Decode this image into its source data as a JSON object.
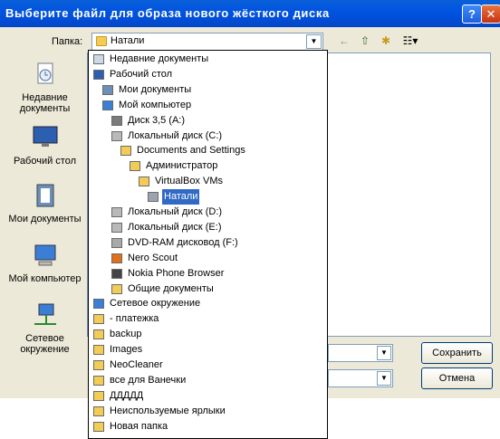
{
  "dialog": {
    "title": "Выберите файл для образа нового жёсткого диска",
    "help_label": "?",
    "close_label": "✕"
  },
  "lookin": {
    "label": "Папка:",
    "value": "Натали"
  },
  "toolbar": {
    "back": "←",
    "up": "⇧",
    "new_folder": "✱",
    "views": "☷▾"
  },
  "places": [
    {
      "label": "Недавние документы",
      "icon": "recent-documents-icon"
    },
    {
      "label": "Рабочий стол",
      "icon": "desktop-icon"
    },
    {
      "label": "Мои документы",
      "icon": "my-documents-icon"
    },
    {
      "label": "Мой компьютер",
      "icon": "my-computer-icon"
    },
    {
      "label": "Сетевое окружение",
      "icon": "network-icon"
    }
  ],
  "dropdown": {
    "items": [
      {
        "label": "Недавние документы",
        "indent": 0,
        "icon": "recent-icon"
      },
      {
        "label": "Рабочий стол",
        "indent": 0,
        "icon": "desktop-icon"
      },
      {
        "label": "Мои документы",
        "indent": 1,
        "icon": "my-documents-icon"
      },
      {
        "label": "Мой компьютер",
        "indent": 1,
        "icon": "computer-icon"
      },
      {
        "label": "Диск 3,5 (A:)",
        "indent": 2,
        "icon": "floppy-icon"
      },
      {
        "label": "Локальный диск (C:)",
        "indent": 2,
        "icon": "drive-icon"
      },
      {
        "label": "Documents and Settings",
        "indent": 3,
        "icon": "folder-icon"
      },
      {
        "label": "Администратор",
        "indent": 4,
        "icon": "folder-icon"
      },
      {
        "label": "VirtualBox VMs",
        "indent": 5,
        "icon": "folder-icon"
      },
      {
        "label": "Натали",
        "indent": 6,
        "icon": "folder-gray-icon",
        "selected": true
      },
      {
        "label": "Локальный диск (D:)",
        "indent": 2,
        "icon": "drive-icon"
      },
      {
        "label": "Локальный диск (E:)",
        "indent": 2,
        "icon": "drive-icon"
      },
      {
        "label": "DVD-RAM дисковод (F:)",
        "indent": 2,
        "icon": "dvd-icon"
      },
      {
        "label": "Nero Scout",
        "indent": 2,
        "icon": "nero-icon"
      },
      {
        "label": "Nokia Phone Browser",
        "indent": 2,
        "icon": "phone-icon"
      },
      {
        "label": "Общие документы",
        "indent": 2,
        "icon": "folder-icon"
      },
      {
        "label": "Сетевое окружение",
        "indent": 0,
        "icon": "network-icon"
      },
      {
        "label": "- платежка",
        "indent": 0,
        "icon": "folder-icon"
      },
      {
        "label": "backup",
        "indent": 0,
        "icon": "folder-icon"
      },
      {
        "label": "Images",
        "indent": 0,
        "icon": "folder-icon"
      },
      {
        "label": "NeoCleaner",
        "indent": 0,
        "icon": "folder-icon"
      },
      {
        "label": "все для Ванечки",
        "indent": 0,
        "icon": "folder-icon"
      },
      {
        "label": "ДДДДД",
        "indent": 0,
        "icon": "folder-icon"
      },
      {
        "label": "Неиспользуемые ярлыки",
        "indent": 0,
        "icon": "folder-icon"
      },
      {
        "label": "Новая папка",
        "indent": 0,
        "icon": "folder-icon"
      }
    ]
  },
  "filename": {
    "value": ""
  },
  "filetype": {
    "value": ""
  },
  "buttons": {
    "save": "Сохранить",
    "cancel": "Отмена"
  }
}
